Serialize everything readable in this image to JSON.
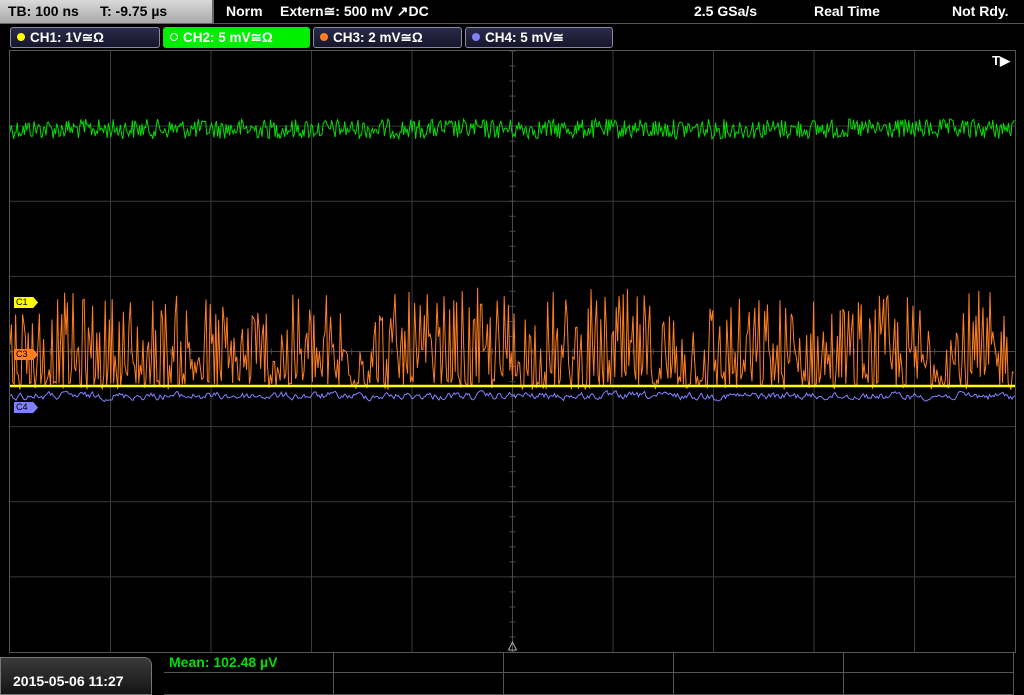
{
  "topbar": {
    "timebase": "TB: 100 ns",
    "trigger_time": "T: -9.75 µs",
    "mode": "Norm",
    "trigger_source": "Extern≅: 500 mV ↗DC",
    "sample_rate": "2.5 GSa/s",
    "acq_mode": "Real Time",
    "state": "Not Rdy."
  },
  "channels": [
    {
      "label": "CH1: 1V≅Ω",
      "color": "#ffff00",
      "active": false
    },
    {
      "label": "CH2: 5 mV≅Ω",
      "color": "#00dd00",
      "active": true
    },
    {
      "label": "CH3: 2 mV≅Ω",
      "color": "#ff7f20",
      "active": false
    },
    {
      "label": "CH4: 5 mV≅",
      "color": "#8080ff",
      "active": false
    }
  ],
  "plot": {
    "trigger_indicator": "T▶",
    "markers": {
      "c1": "C1",
      "c3": "C3",
      "c4": "C4"
    }
  },
  "footer": {
    "datetime": "2015-05-06 11:27",
    "measurement": "Mean: 102.48 µV"
  },
  "colors": {
    "ch1": "#ffff00",
    "ch2": "#00dd00",
    "ch3": "#ff7f20",
    "ch4": "#8080ff",
    "grid": "#3a3a3a"
  }
}
